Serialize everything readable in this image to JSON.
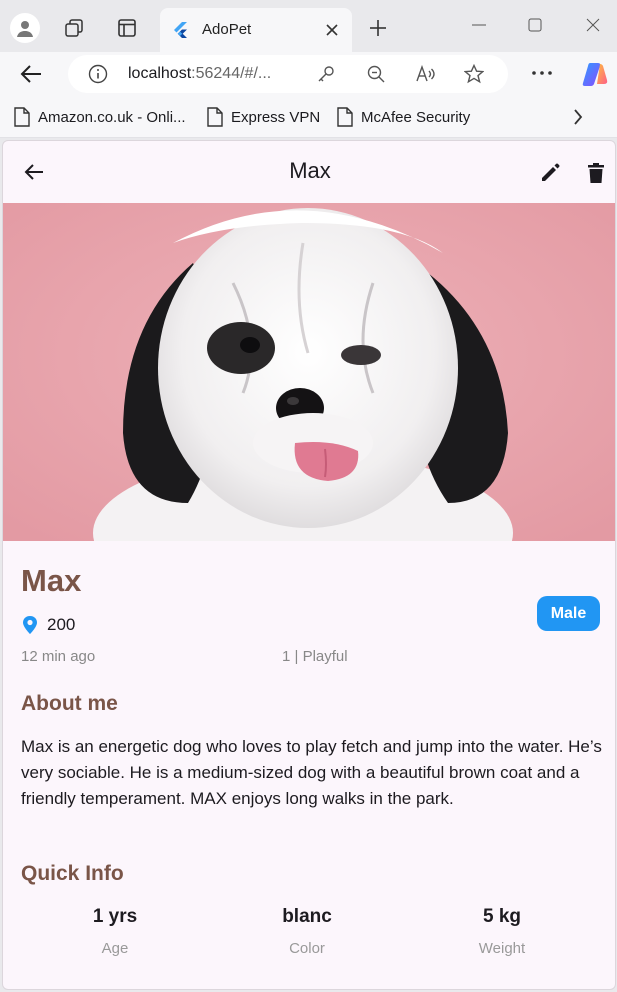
{
  "browser": {
    "tab_title": "AdoPet",
    "url_host": "localhost",
    "url_rest": ":56244/#/...",
    "bookmarks": [
      {
        "label": "Amazon.co.uk - Onli..."
      },
      {
        "label": "Express VPN"
      },
      {
        "label": "McAfee Security"
      }
    ]
  },
  "app": {
    "title": "Max",
    "hero_icon": "dog-photo-image"
  },
  "pet": {
    "name": "Max",
    "location": "200",
    "gender": "Male",
    "posted": "12 min ago",
    "meta": "1 | Playful"
  },
  "about": {
    "heading": "About me",
    "text": "Max is an energetic dog who loves to play fetch and jump into the water. He’s very sociable. He is a medium-sized dog with a beautiful brown coat and a friendly temperament. MAX enjoys long walks in the park."
  },
  "quick_info": {
    "heading": "Quick Info",
    "items": [
      {
        "value": "1 yrs",
        "label": "Age"
      },
      {
        "value": "blanc",
        "label": "Color"
      },
      {
        "value": "5 kg",
        "label": "Weight"
      }
    ]
  },
  "colors": {
    "accent_brown": "#7a5548",
    "badge_blue": "#2196f3",
    "hero_pink": "#e8a2ab"
  }
}
